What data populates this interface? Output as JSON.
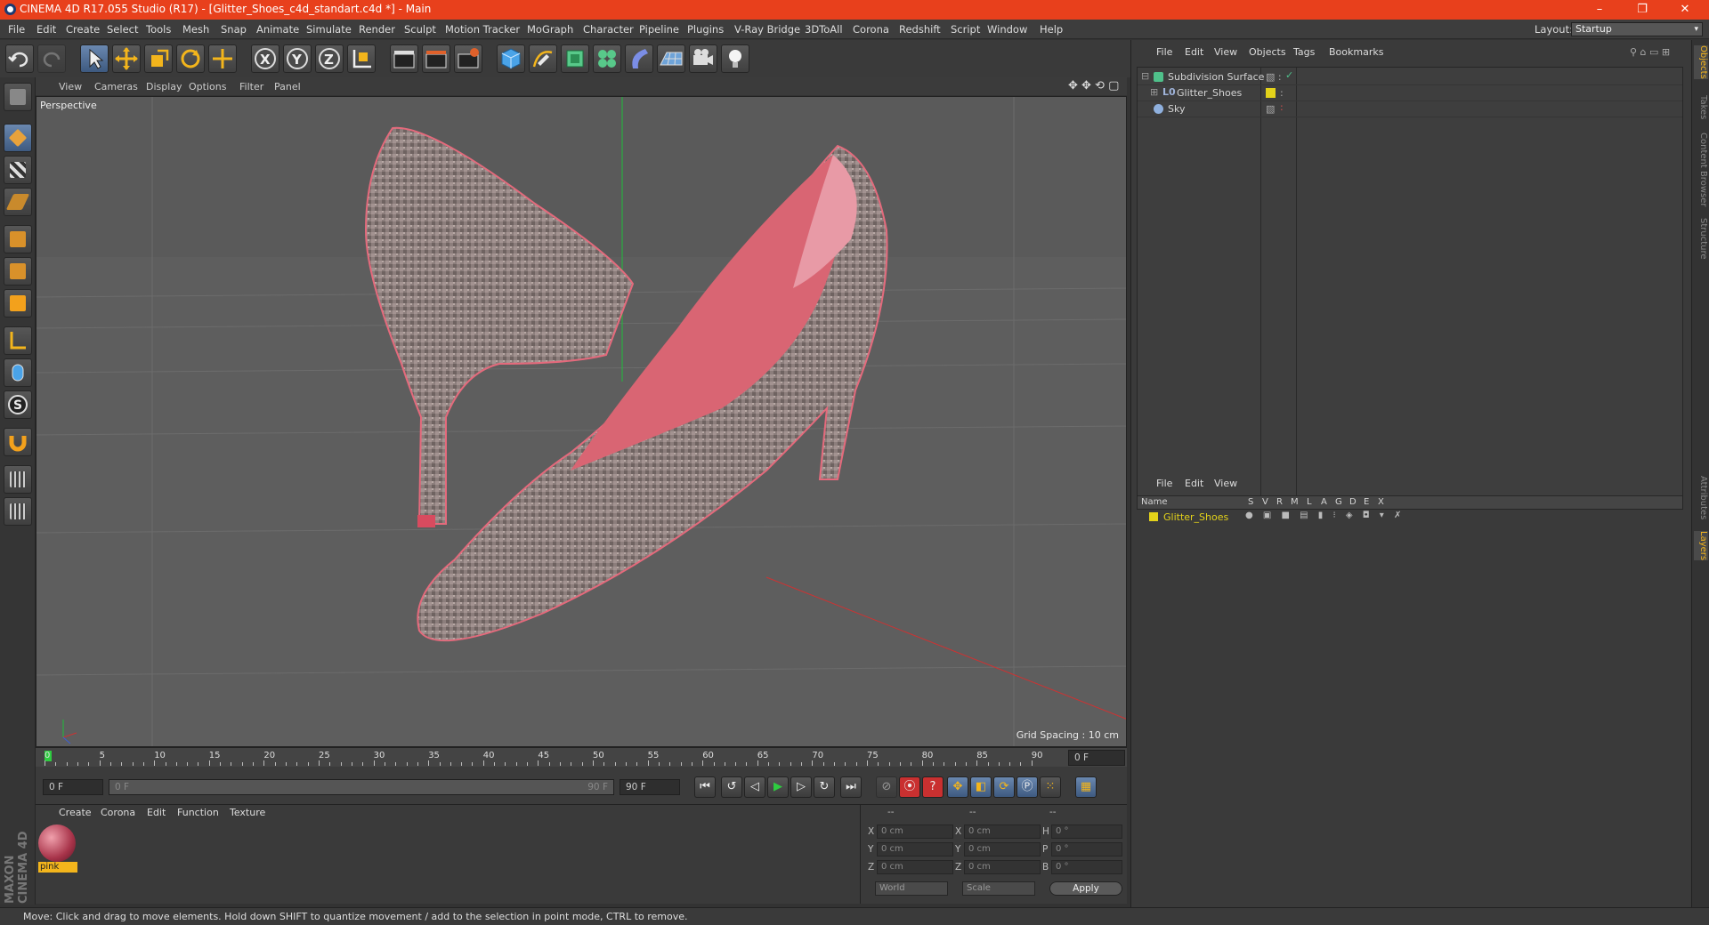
{
  "window": {
    "title": "CINEMA 4D R17.055 Studio (R17) - [Glitter_Shoes_c4d_standart.c4d *] - Main",
    "controls": [
      "–",
      "❐",
      "✕"
    ]
  },
  "menubar": {
    "items": [
      "File",
      "Edit",
      "Create",
      "Select",
      "Tools",
      "Mesh",
      "Snap",
      "Animate",
      "Simulate",
      "Render",
      "Sculpt",
      "Motion Tracker",
      "MoGraph",
      "Character",
      "Pipeline",
      "Plugins",
      "V-Ray Bridge",
      "3DToAll",
      "Corona",
      "Redshift",
      "Script",
      "Window",
      "Help"
    ],
    "layout_label": "Layout:",
    "layout_value": "Startup"
  },
  "viewport": {
    "menu": [
      "View",
      "Cameras",
      "Display",
      "Options",
      "Filter",
      "Panel"
    ],
    "label": "Perspective",
    "grid_spacing": "Grid Spacing : 10 cm"
  },
  "timeline": {
    "ticks": [
      "0",
      "5",
      "10",
      "15",
      "20",
      "25",
      "30",
      "35",
      "40",
      "45",
      "50",
      "55",
      "60",
      "65",
      "70",
      "75",
      "80",
      "85",
      "90"
    ],
    "current_frame_field": "0 F",
    "start_field": "0 F",
    "range_start": "0 F",
    "range_end": "90 F",
    "end_field": "90 F"
  },
  "material_manager": {
    "menu": [
      "Create",
      "Corona",
      "Edit",
      "Function",
      "Texture"
    ],
    "material_name": "pink"
  },
  "coordinates": {
    "header": [
      "--",
      "--",
      "--"
    ],
    "rows": [
      {
        "a": "X",
        "av": "0 cm",
        "b": "X",
        "bv": "0 cm",
        "c": "H",
        "cv": "0 °"
      },
      {
        "a": "Y",
        "av": "0 cm",
        "b": "Y",
        "bv": "0 cm",
        "c": "P",
        "cv": "0 °"
      },
      {
        "a": "Z",
        "av": "0 cm",
        "b": "Z",
        "bv": "0 cm",
        "c": "B",
        "cv": "0 °"
      }
    ],
    "world": "World",
    "scale": "Scale",
    "apply": "Apply"
  },
  "object_manager": {
    "menu": [
      "File",
      "Edit",
      "View",
      "Objects",
      "Tags",
      "Bookmarks"
    ],
    "objects": [
      {
        "name": "Subdivision Surface",
        "color": "#4fc08a"
      },
      {
        "name": "Glitter_Shoes",
        "color": "#9fb3d9"
      },
      {
        "name": "Sky",
        "color": "#8fb0de"
      }
    ]
  },
  "layer_manager": {
    "menu": [
      "File",
      "Edit",
      "View"
    ],
    "columns": [
      "Name",
      "S",
      "V",
      "R",
      "M",
      "L",
      "A",
      "G",
      "D",
      "E",
      "X"
    ],
    "layer_name": "Glitter_Shoes",
    "layer_color": "#e3d21a"
  },
  "side_tabs": [
    "Objects",
    "Takes",
    "Content Browser",
    "Structure",
    "Attributes",
    "Layers"
  ],
  "status": "Move: Click and drag to move elements. Hold down SHIFT to quantize movement / add to the selection in point mode, CTRL to remove.",
  "brand": "MAXON CINEMA 4D"
}
